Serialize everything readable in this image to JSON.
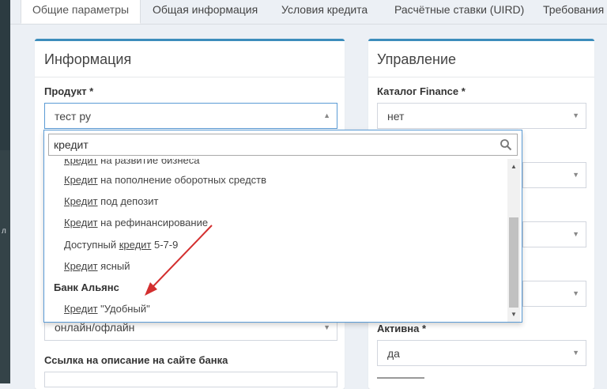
{
  "tabs": [
    "Общие параметры",
    "Общая информация",
    "Условия кредита",
    "Расчётные ставки (UIRD)",
    "Требования к"
  ],
  "info": {
    "title": "Информация",
    "product_label": "Продукт *",
    "product_value": "тест ру",
    "channel_value": "онлайн/офлайн",
    "link_label": "Ссылка на описание на сайте банка"
  },
  "dropdown": {
    "search_value": "кредит",
    "clipped_option": {
      "hl": "Кредит",
      "rest": " на развитие бизнеса"
    },
    "options": [
      {
        "pre": "",
        "hl": "Кредит",
        "rest": " на пополнение оборотных средств"
      },
      {
        "pre": "",
        "hl": "Кредит",
        "rest": " под депозит"
      },
      {
        "pre": "",
        "hl": "Кредит",
        "rest": " на рефинансирование"
      },
      {
        "pre": "Доступный ",
        "hl": "кредит",
        "rest": " 5-7-9"
      },
      {
        "pre": "",
        "hl": "Кредит",
        "rest": " ясный"
      }
    ],
    "group_label": "Банк Альянс",
    "group_option": {
      "pre": "",
      "hl": "Кредит",
      "rest": " \"Удобный\""
    }
  },
  "manage": {
    "title": "Управление",
    "catalog_label": "Каталог Finance *",
    "catalog_value": "нет",
    "active_label": "Активна *",
    "active_value": "да"
  },
  "colors": {
    "accent": "#3c8dbc",
    "annotation_arrow": "#d32f2f"
  }
}
